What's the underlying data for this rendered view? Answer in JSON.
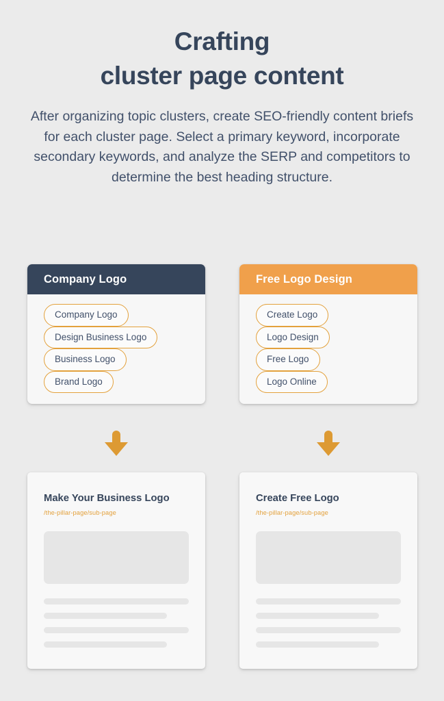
{
  "header": {
    "title_line_1": "Crafting",
    "title_line_2": "cluster page content",
    "intro": "After organizing topic clusters, create SEO-friendly content briefs for each cluster page. Select a primary keyword, incorporate secondary keywords, and analyze the SERP and competitors to determine the best heading structure."
  },
  "colors": {
    "background": "#ebebeb",
    "navy": "#36455b",
    "orange": "#f0a04b",
    "pill_border": "#e3a13c",
    "arrow": "#dd9a33",
    "skeleton": "#e6e6e6",
    "card_background": "#f7f7f7"
  },
  "clusters": [
    {
      "header_label": "Company Logo",
      "header_style": "navy",
      "keywords": [
        "Company Logo",
        "Design Business Logo",
        "Business Logo",
        "Brand Logo"
      ],
      "arrow_icon": "arrow-down-icon",
      "page": {
        "title": "Make Your Business Logo",
        "url": "/the-pillar-page/sub-page",
        "skeleton_lines": [
          "full",
          "short",
          "full",
          "short"
        ]
      }
    },
    {
      "header_label": "Free Logo Design",
      "header_style": "orange",
      "keywords": [
        "Create Logo",
        "Logo Design",
        "Free Logo",
        "Logo Online"
      ],
      "arrow_icon": "arrow-down-icon",
      "page": {
        "title": "Create Free Logo",
        "url": "/the-pillar-page/sub-page",
        "skeleton_lines": [
          "full",
          "short",
          "full",
          "short"
        ]
      }
    }
  ]
}
